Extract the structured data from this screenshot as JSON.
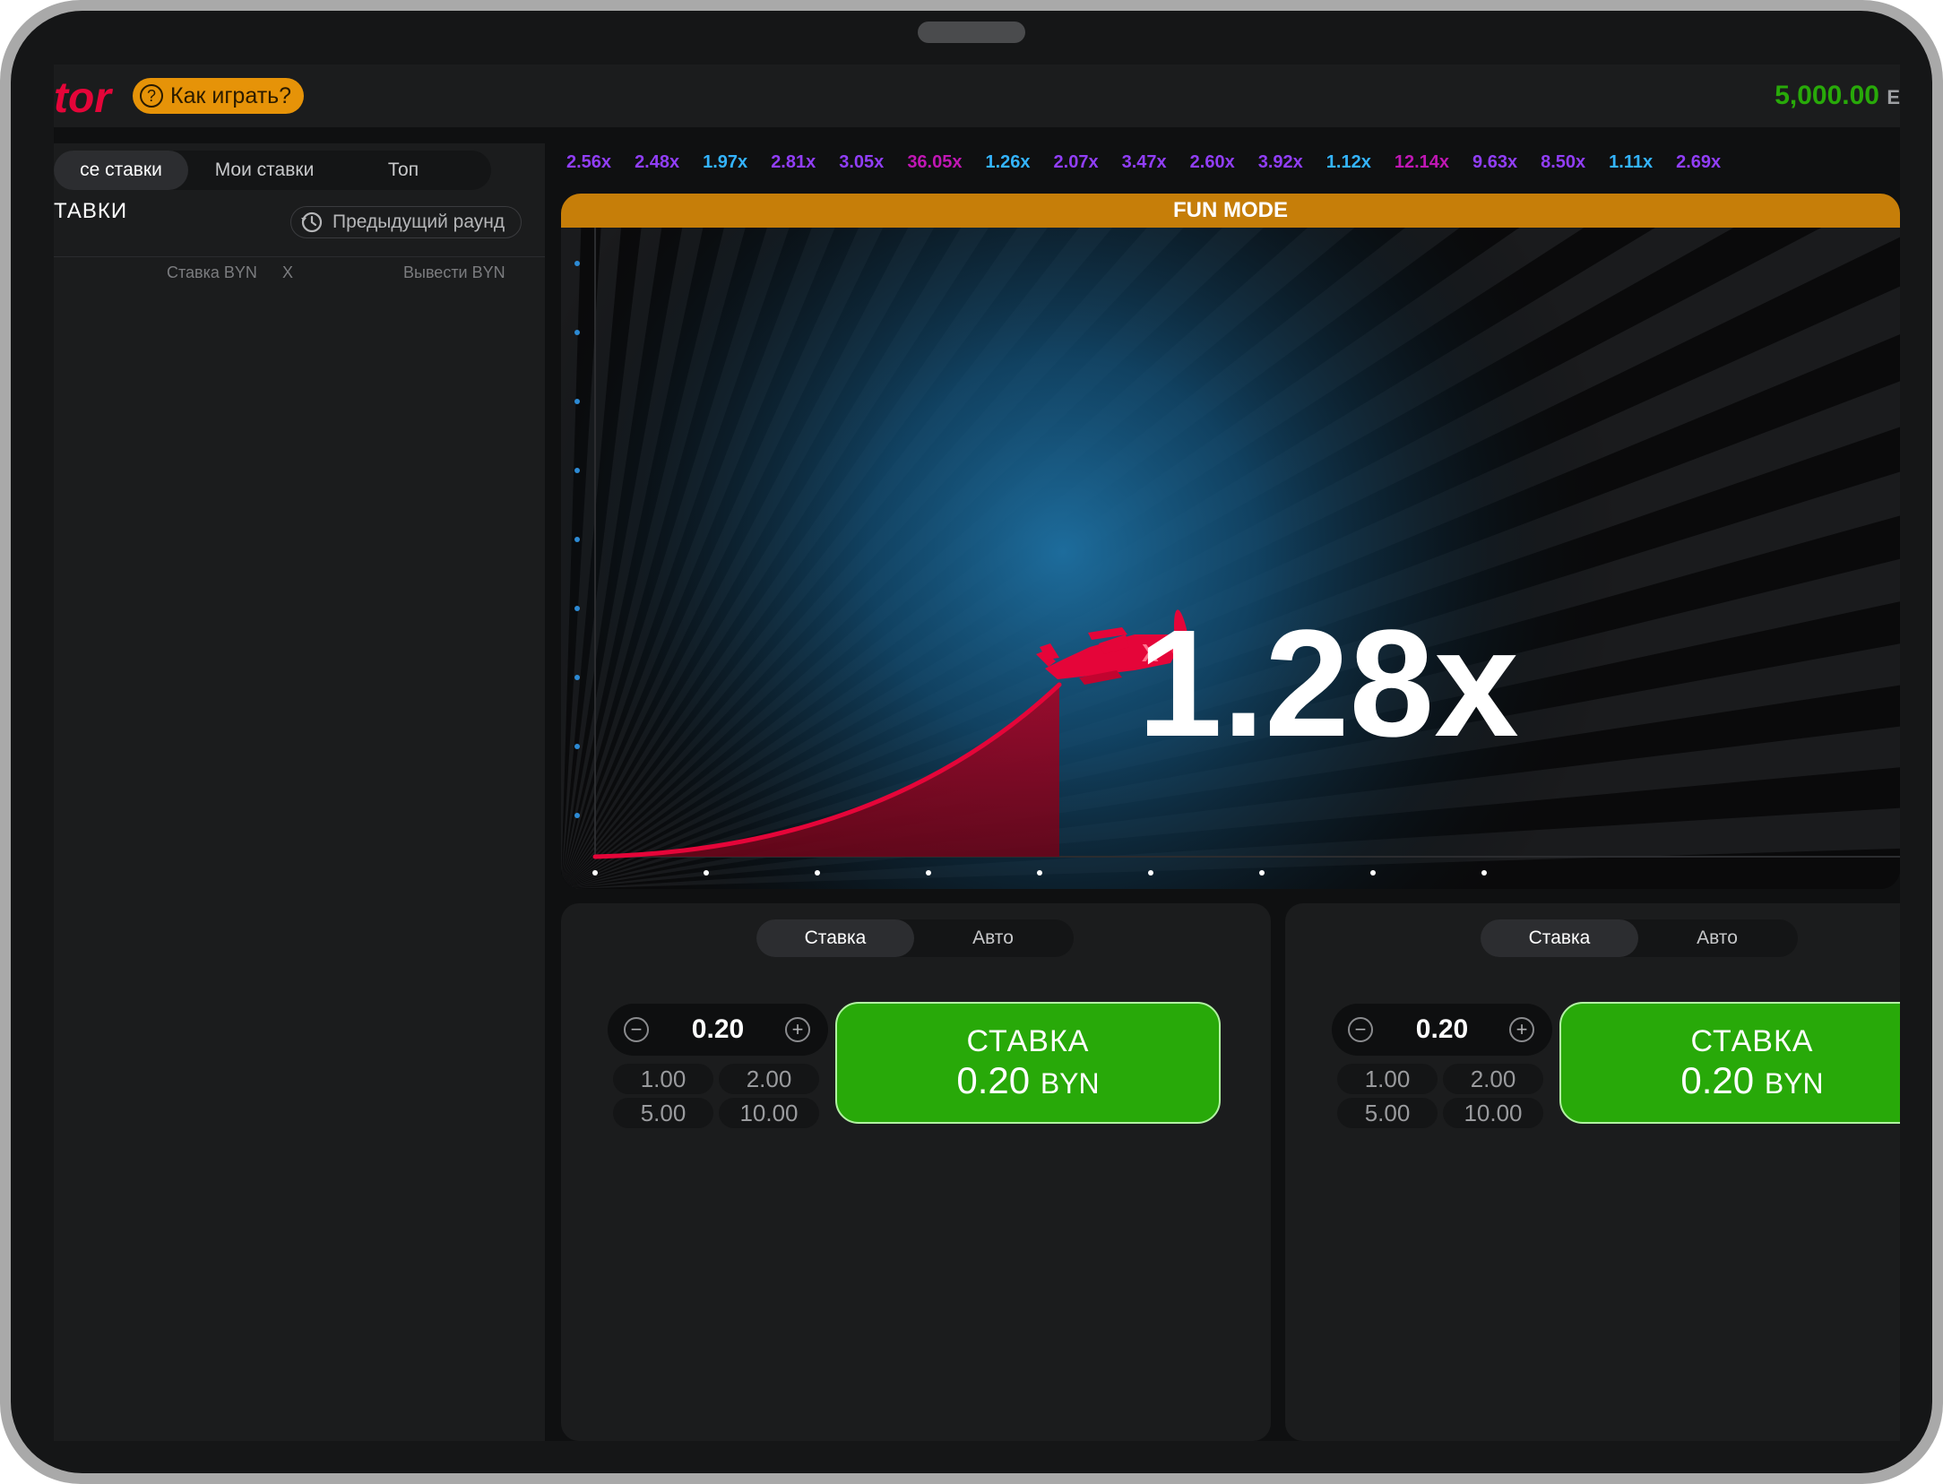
{
  "header": {
    "logo_text": "tor",
    "how_to_play": "Как играть?",
    "balance": "5,000.00",
    "balance_currency": "E"
  },
  "left_panel": {
    "tabs": [
      "се ставки",
      "Мои ставки",
      "Топ"
    ],
    "active_tab": 0,
    "title": "ТАВКИ",
    "previous_round": "Предыдущий раунд",
    "columns": {
      "bet": "Ставка BYN",
      "x": "X",
      "cashout": "Вывести BYN"
    }
  },
  "history": [
    {
      "value": "2.56x",
      "color": "#913ef8"
    },
    {
      "value": "2.48x",
      "color": "#913ef8"
    },
    {
      "value": "1.97x",
      "color": "#34b4ff"
    },
    {
      "value": "2.81x",
      "color": "#913ef8"
    },
    {
      "value": "3.05x",
      "color": "#913ef8"
    },
    {
      "value": "36.05x",
      "color": "#c017b4"
    },
    {
      "value": "1.26x",
      "color": "#34b4ff"
    },
    {
      "value": "2.07x",
      "color": "#913ef8"
    },
    {
      "value": "3.47x",
      "color": "#913ef8"
    },
    {
      "value": "2.60x",
      "color": "#913ef8"
    },
    {
      "value": "3.92x",
      "color": "#913ef8"
    },
    {
      "value": "1.12x",
      "color": "#34b4ff"
    },
    {
      "value": "12.14x",
      "color": "#c017b4"
    },
    {
      "value": "9.63x",
      "color": "#913ef8"
    },
    {
      "value": "8.50x",
      "color": "#913ef8"
    },
    {
      "value": "1.11x",
      "color": "#34b4ff"
    },
    {
      "value": "2.69x",
      "color": "#913ef8"
    }
  ],
  "game": {
    "fun_mode": "FUN MODE",
    "multiplier": "1.28x",
    "plane_marking": "X",
    "colors": {
      "plane": "#e50539",
      "accent": "#c67e09",
      "glow": "#1d6c9c"
    }
  },
  "bet_panels": [
    {
      "tabs": [
        "Ставка",
        "Авто"
      ],
      "active_tab": 0,
      "amount": "0.20",
      "quick": [
        "1.00",
        "2.00",
        "5.00",
        "10.00"
      ],
      "button_label": "СТАВКА",
      "button_amount": "0.20",
      "button_currency": "BYN",
      "minus": "−",
      "plus": "+"
    },
    {
      "tabs": [
        "Ставка",
        "Авто"
      ],
      "active_tab": 0,
      "amount": "0.20",
      "quick": [
        "1.00",
        "2.00",
        "5.00",
        "10.00"
      ],
      "button_label": "СТАВКА",
      "button_amount": "0.20",
      "button_currency": "BYN",
      "minus": "−",
      "plus": "+"
    }
  ]
}
